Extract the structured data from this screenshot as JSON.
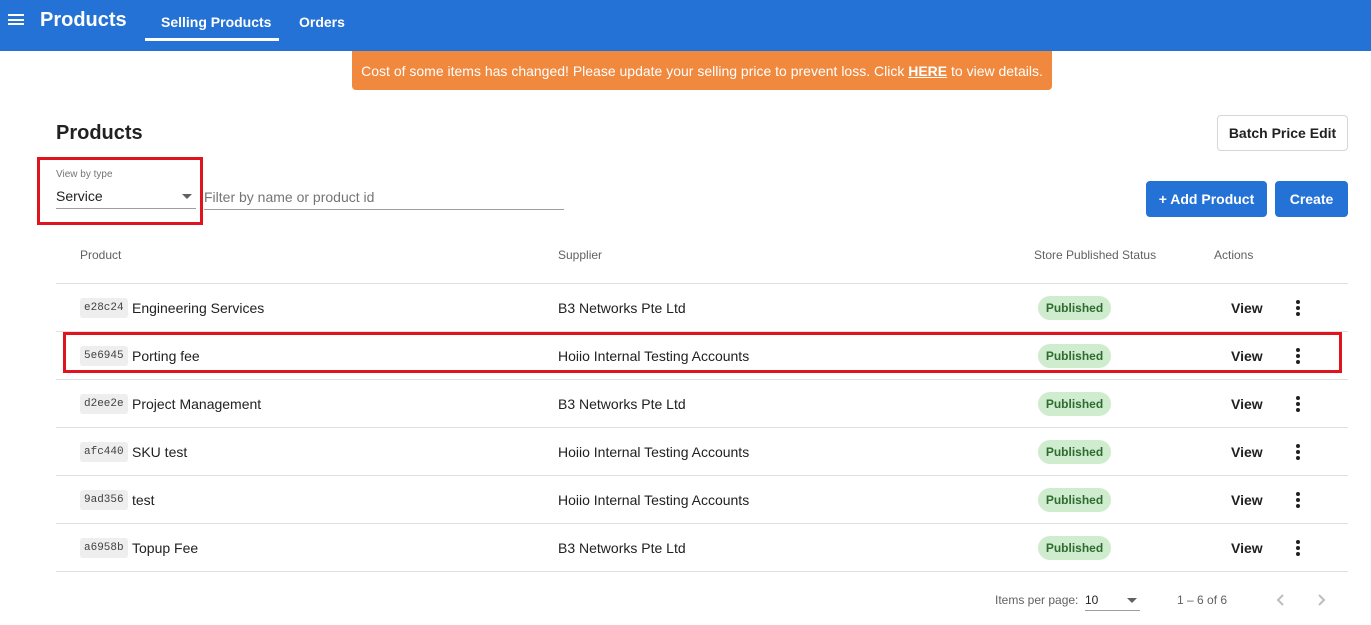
{
  "header": {
    "app_title": "Products",
    "tabs": [
      {
        "label": "Selling Products"
      },
      {
        "label": "Orders"
      }
    ]
  },
  "banner": {
    "text_before": "Cost of some items has changed! Please update your selling price to prevent loss. Click ",
    "link": "HERE",
    "text_after": " to view details.",
    "color": "#f0883d"
  },
  "page": {
    "title": "Products"
  },
  "toolbar": {
    "batch_price_edit_label": "Batch Price Edit",
    "add_product_label": "+ Add Product",
    "create_label": "Create"
  },
  "filters": {
    "type_label": "View by type",
    "type_value": "Service",
    "search_placeholder": "Filter by name or product id"
  },
  "table": {
    "headers": {
      "product": "Product",
      "supplier": "Supplier",
      "status": "Store Published Status",
      "actions": "Actions"
    },
    "view_label": "View",
    "rows": [
      {
        "id": "e28c24",
        "name": "Engineering Services",
        "supplier": "B3 Networks Pte Ltd",
        "status": "Published"
      },
      {
        "id": "5e6945",
        "name": "Porting fee",
        "supplier": "Hoiio Internal Testing Accounts",
        "status": "Published"
      },
      {
        "id": "d2ee2e",
        "name": "Project Management",
        "supplier": "B3 Networks Pte Ltd",
        "status": "Published"
      },
      {
        "id": "afc440",
        "name": "SKU test",
        "supplier": "Hoiio Internal Testing Accounts",
        "status": "Published"
      },
      {
        "id": "9ad356",
        "name": "test",
        "supplier": "Hoiio Internal Testing Accounts",
        "status": "Published"
      },
      {
        "id": "a6958b",
        "name": "Topup Fee",
        "supplier": "B3 Networks Pte Ltd",
        "status": "Published"
      }
    ]
  },
  "pagination": {
    "items_per_page_label": "Items per page:",
    "items_per_page_value": "10",
    "range_label": "1 – 6 of 6"
  },
  "colors": {
    "primary": "#2472d5",
    "highlight": "#e0141f",
    "published_bg": "#cfeccf",
    "published_text": "#2e6b2e"
  }
}
